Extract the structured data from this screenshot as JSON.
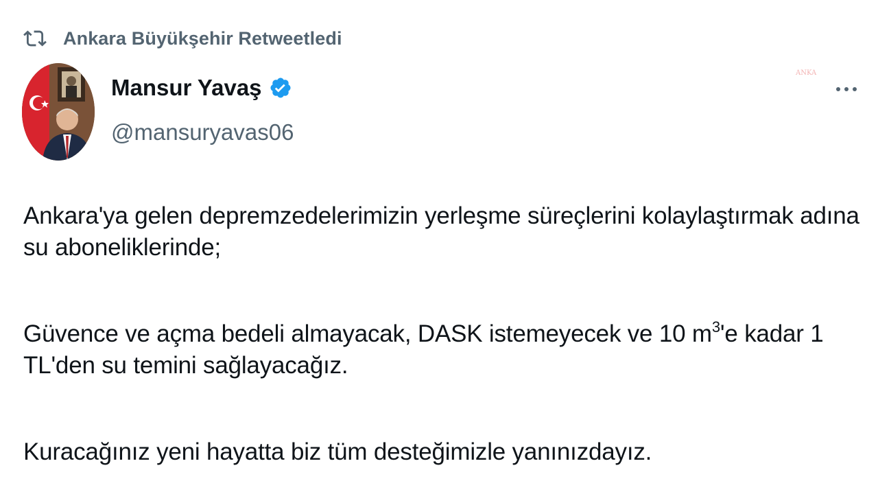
{
  "retweet": {
    "icon": "retweet-icon",
    "text": "Ankara Büyükşehir Retweetledi"
  },
  "author": {
    "display_name": "Mansur Yavaş",
    "verified_icon": "verified-badge-icon",
    "handle": "@mansuryavas06",
    "avatar": "profile-photo"
  },
  "more_icon": "more-options-icon",
  "watermark": "ANKA",
  "tweet": {
    "paragraph1": "Ankara'ya gelen depremzedelerimizin yerleşme süreçlerini kolaylaştırmak adına su aboneliklerinde;",
    "paragraph2_part1": "Güvence ve açma bedeli almayacak, DASK istemeyecek ve 10 m",
    "paragraph2_sup": "3",
    "paragraph2_part2": "'e kadar 1 TL'den su temini sağlayacağız.",
    "paragraph3": "Kuracağınız yeni hayatta biz tüm desteğimizle yanınızdayız."
  },
  "colors": {
    "primary_text": "#0f1419",
    "secondary_text": "#536471",
    "verified_blue": "#1d9bf0"
  }
}
